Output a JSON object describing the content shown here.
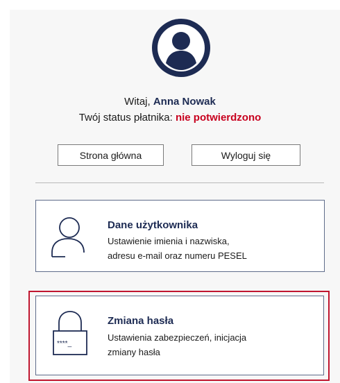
{
  "header": {
    "greeting_prefix": "Witaj, ",
    "user_name": "Anna Nowak",
    "status_prefix": "Twój status płatnika: ",
    "status_value": "nie potwierdzono",
    "status_color": "#c8001e",
    "avatar_icon": "user-avatar-icon"
  },
  "actions": {
    "home_label": "Strona główna",
    "logout_label": "Wyloguj się"
  },
  "cards": [
    {
      "title": "Dane użytkownika",
      "description_line1": "Ustawienie imienia i nazwiska,",
      "description_line2": "adresu e-mail oraz numeru PESEL",
      "icon": "user-outline-icon"
    },
    {
      "title": "Zmiana hasła",
      "description_line1": "Ustawienia zabezpieczeń, inicjacja",
      "description_line2": "zmiany hasła",
      "icon": "lock-icon",
      "icon_text": "****_",
      "highlight_color": "#c0162f"
    }
  ],
  "colors": {
    "brand": "#1d2b53",
    "card_border": "#5e6b8a"
  }
}
